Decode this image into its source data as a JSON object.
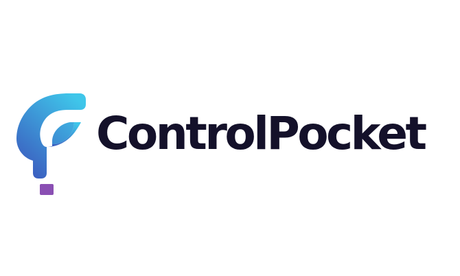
{
  "brand": {
    "name": "ControlPocket",
    "text_color": "#14112a",
    "mark_gradient_start": "#3fc6ea",
    "mark_gradient_end": "#3b5fc0",
    "mark_dot_color": "#8a4fb3",
    "logo_icon": "pocket-leaf-icon"
  }
}
